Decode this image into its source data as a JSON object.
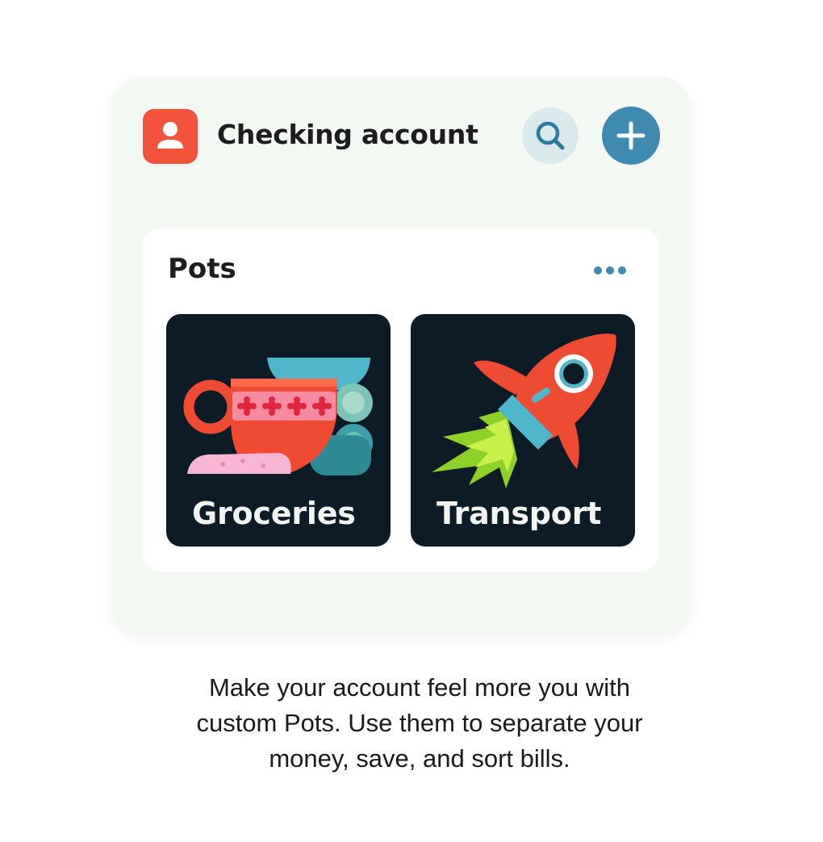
{
  "header": {
    "title": "Checking account",
    "avatar_icon": "user-icon",
    "search_icon": "search-icon",
    "add_icon": "plus-icon"
  },
  "pots": {
    "title": "Pots",
    "more_icon": "more-dots-icon",
    "items": [
      {
        "label": "Groceries",
        "icon": "teacup-illustration"
      },
      {
        "label": "Transport",
        "icon": "rocket-illustration"
      }
    ]
  },
  "caption": {
    "line1": "Make your account feel more you with",
    "line2": "custom Pots. Use them to separate your",
    "line3": "money, save, and sort bills."
  },
  "colors": {
    "avatar": "#f4533b",
    "add_button": "#3f8ab0",
    "search_button": "#d9e9ec",
    "tile_background": "#0d1b26",
    "card_background": "#f4f8f3"
  }
}
